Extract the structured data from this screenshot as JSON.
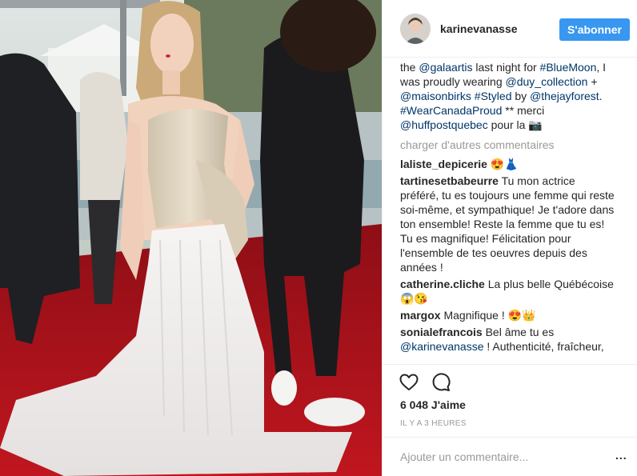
{
  "header": {
    "username": "karinevanasse",
    "follow_label": "S'abonner"
  },
  "caption": {
    "segments": [
      {
        "text": "the ",
        "kind": "t"
      },
      {
        "text": "@galaartis",
        "kind": "tag"
      },
      {
        "text": " last night for ",
        "kind": "t"
      },
      {
        "text": "#BlueMoon",
        "kind": "tag"
      },
      {
        "text": ", I was proudly wearing ",
        "kind": "t"
      },
      {
        "text": "@duy_collection",
        "kind": "tag"
      },
      {
        "text": " + ",
        "kind": "t"
      },
      {
        "text": "@maisonbirks",
        "kind": "tag"
      },
      {
        "text": " ",
        "kind": "t"
      },
      {
        "text": "#Styled",
        "kind": "tag"
      },
      {
        "text": " by ",
        "kind": "t"
      },
      {
        "text": "@thejayforest",
        "kind": "tag"
      },
      {
        "text": ". ",
        "kind": "t"
      },
      {
        "text": "#WearCanadaProud",
        "kind": "tag"
      },
      {
        "text": " ** merci ",
        "kind": "t"
      },
      {
        "text": "@huffpostquebec",
        "kind": "tag"
      },
      {
        "text": " pour la 📷",
        "kind": "t"
      }
    ]
  },
  "load_more": "charger d'autres commentaires",
  "comments": [
    {
      "user": "laliste_depicerie",
      "parts": [
        {
          "text": "😍👗",
          "kind": "t"
        }
      ]
    },
    {
      "user": "tartinesetbabeurre",
      "parts": [
        {
          "text": "Tu mon actrice préféré, tu es toujours une femme qui reste soi-même, et sympathique! Je t'adore dans ton ensemble! Reste la femme que tu es! Tu es magnifique! Félicitation pour l'ensemble de tes oeuvres depuis des années !",
          "kind": "t"
        }
      ]
    },
    {
      "user": "catherine.cliche",
      "parts": [
        {
          "text": "La plus belle Québécoise 😱😘",
          "kind": "t"
        }
      ]
    },
    {
      "user": "margox",
      "parts": [
        {
          "text": "Magnifique ! 😍👑",
          "kind": "t"
        }
      ]
    },
    {
      "user": "sonialefrancois",
      "parts": [
        {
          "text": "Bel âme tu es ",
          "kind": "t"
        },
        {
          "text": "@karinevanasse",
          "kind": "mention"
        },
        {
          "text": " ! Authenticité, fraîcheur,",
          "kind": "t"
        }
      ]
    }
  ],
  "actions": {
    "like_icon": "heart-icon",
    "comment_icon": "comment-bubble-icon"
  },
  "likes_text": "6 048 J'aime",
  "timestamp": "IL Y A 3 HEURES",
  "add_comment": {
    "placeholder": "Ajouter un commentaire...",
    "more_label": "..."
  },
  "colors": {
    "follow_button": "#3897f0",
    "hashtag": "#003569",
    "muted": "#999999",
    "carpet": "#b3121c"
  }
}
